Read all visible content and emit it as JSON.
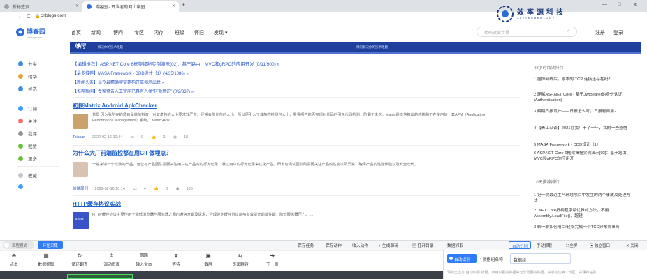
{
  "browser": {
    "tabs": [
      {
        "label": "新标签页",
        "active": false
      },
      {
        "label": "博客园 - 开发者的网上家园",
        "active": true
      }
    ],
    "new_tab": "+",
    "url": "cnblogs.com",
    "nav_back": "←",
    "nav_forward": "→",
    "nav_reload": "C",
    "win_controls": [
      "—",
      "□",
      "✕"
    ]
  },
  "watermark": {
    "title": "效率源科技",
    "subtitle": "XLYTECHNOLOGY"
  },
  "site": {
    "brand": "博客园",
    "brand_domain": "cnblogs.com",
    "nav": [
      "首页",
      "新闻",
      "博问",
      "专区",
      "闪存",
      "班级",
      "怀旧",
      "发现 ▾"
    ],
    "search_placeholder": "代码改变世界",
    "register": "注册",
    "login": "登录",
    "banner_title": "博问",
    "banner_sub": "解决你的技术难题",
    "banner_right": "博问解决你的技术难题"
  },
  "sidebar": [
    {
      "label": "分类",
      "color": "#3a8ee6"
    },
    {
      "label": "精华",
      "color": "#e6a23c"
    },
    {
      "label": "候选",
      "color": "#3a8ee6"
    },
    {
      "label": "订阅",
      "color": "#409eff"
    },
    {
      "label": "关注",
      "color": "#f56c6c"
    },
    {
      "label": "我评",
      "color": "#909399"
    },
    {
      "label": "我赞",
      "color": "#67c23a"
    },
    {
      "label": "更多",
      "color": "#67c23a"
    },
    {
      "label": "收藏",
      "color": "#c0c4cc"
    },
    {
      "label": "",
      "color": "#409eff"
    }
  ],
  "headlines": [
    "【编辑推荐】ASP.NET Core 6框架揭秘实例演示[02]：基于路由、MVC和gRPC的应用开发 (0/11/900) »",
    "【最多推荐】MASA Framework - DDD设计（1）(4/35/1086) »",
    "【新闻头条】当今最精确宇宙建构开拿揭示出世 »",
    "【推荐新闻】专家警告人工智能已具有人类\"轻微意识\" (0/2/837) »"
  ],
  "posts": [
    {
      "title": "初探Matrix Android ApkChecker",
      "excerpt": "背景 因为我所在的项目是做仿抖音，对安卓包的大小要求较严苛。经常会优化包的大小，所以便引入了其静态检测包大小，看看哪些能否实现对代码的引用代码检测，防漏于未然。Matrix是微信推出的终端和正在使用的一套APM（Application Performance Management）系统。 Matrix-ApkC ...",
      "author": "Tsissan",
      "date": "2022-02-16 10:44",
      "comments": "0",
      "likes": "0",
      "views": "18",
      "thumb_color": "#c9a36b"
    },
    {
      "title": "为什么大厂前端监控都在用GIF做埋点？",
      "excerpt": "一般来讲一个成熟的产品，运营与产品团队需要关注用户在产品内的行为记录，通过用户的行为记录来优化产品，研发与测试团队则需要关注产品的性能以及异常，确保产品的性能体验以及安全迭代。 ...",
      "author": "前端周刊",
      "date": "2022-02-16 10:14",
      "comments": "4",
      "likes": "0",
      "views": "185",
      "thumb_color": "#d8c3b3"
    },
    {
      "title": "HTTP缓存协议实战",
      "excerpt": "HTTP缓存协议主要作用于降低浏览器与服务器之间的通信开销及请求，合理设定缓存协议能够有效提升前端性能，降低服务器压力。 ...",
      "author": "",
      "date": "",
      "comments": "",
      "likes": "",
      "views": "",
      "thumb_color": "#3b53c8"
    }
  ],
  "right_sidebar": {
    "section1_title": "48小时阅读排行",
    "section1": [
      "1 据掉网线后，原本的 TCP 连接还存在吗？",
      "2 理解ASP.NET Core - 基于JwtBearer的身份认证(Authentication)",
      "3 解耦日报设计——日报怎么写，日报有何用?",
      "4 【青工杂谈】2021在我厂干了一年，我的一些感悟",
      "5 MASA Framework - DDD设计（1）",
      "6 ASP.NET Core 6框架揭秘实例演示[02]：基于路由、MVC和gRPC的应用开"
    ],
    "section2_title": "10天推荐排行",
    "section2": [
      "1 记一次最近生产环境项目中发生的两个事故及处理方法",
      "2 .NET Core折柄程序最优雅的方法，不用Assembly.LoadFile()，超越",
      "3 聊一聊如何用C#轻松完成一个TCC分布式事务"
    ]
  },
  "scraper": {
    "toggle_label": "流程模式",
    "start_label": "开始采集",
    "actions": [
      "保存任务",
      "保存动作",
      "收入动作",
      "+ 生成源码",
      "▤ 打开目录"
    ],
    "panel_title": "数据抓取",
    "panel_tabs": [
      "自动识别",
      "手动抓取",
      "⛶ 全屏",
      "▣ 独立窗口",
      "✕ 关闭"
    ],
    "tools": [
      {
        "icon": "⊕",
        "label": "点击"
      },
      {
        "icon": "▦",
        "label": "数据抓取"
      },
      {
        "icon": "↻",
        "label": "循环翻查"
      },
      {
        "icon": "⇕",
        "label": "滚动页面"
      },
      {
        "icon": "⌨",
        "label": "输入文本"
      },
      {
        "icon": "⧗",
        "label": "等待"
      },
      {
        "icon": "▣",
        "label": "截屏"
      },
      {
        "icon": "⇆",
        "label": "页面跳转"
      },
      {
        "icon": "➔",
        "label": "下一页"
      }
    ],
    "auto_button": "自动识别",
    "data_group_label": "* 数据组名称：",
    "data_group_value": "数据组",
    "hint": "请点击上方\"自动识别\"按钮，启用识别的数据中无您需要的数据，并手动切换工作区，并保存任务",
    "hint_highlight": "自动识别"
  }
}
